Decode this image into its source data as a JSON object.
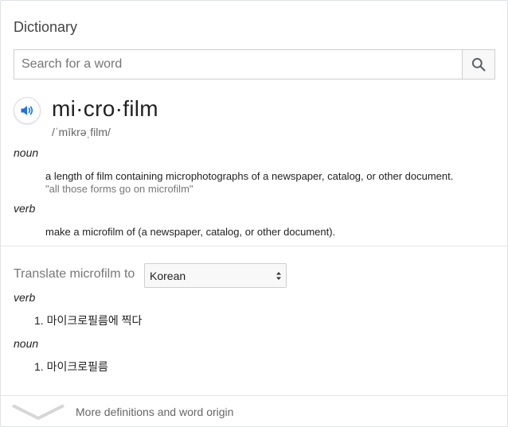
{
  "card": {
    "title": "Dictionary"
  },
  "search": {
    "placeholder": "Search for a word",
    "value": "",
    "icon": "search-icon"
  },
  "entry": {
    "speaker_icon": "speaker-icon",
    "headword": "mi·cro·film",
    "pronunciation": "/ˈmīkrəˌfilm/",
    "senses": [
      {
        "pos": "noun",
        "definition": "a length of film containing microphotographs of a newspaper, catalog, or other document.",
        "example": "\"all those forms go on microfilm\""
      },
      {
        "pos": "verb",
        "definition": "make a microfilm of (a newspaper, catalog, or other document).",
        "example": ""
      }
    ]
  },
  "translate": {
    "label": "Translate microfilm to",
    "selected_language": "Korean",
    "groups": [
      {
        "pos": "verb",
        "items": [
          "1. 마이크로필름에 찍다"
        ]
      },
      {
        "pos": "noun",
        "items": [
          "1. 마이크로필름"
        ]
      }
    ]
  },
  "footer": {
    "more_label": "More definitions and word origin",
    "icon": "chevron-down-icon"
  },
  "colors": {
    "accent_blue": "#1a73e8",
    "text": "#222222",
    "muted": "#777777",
    "border": "#dfe1e5"
  }
}
